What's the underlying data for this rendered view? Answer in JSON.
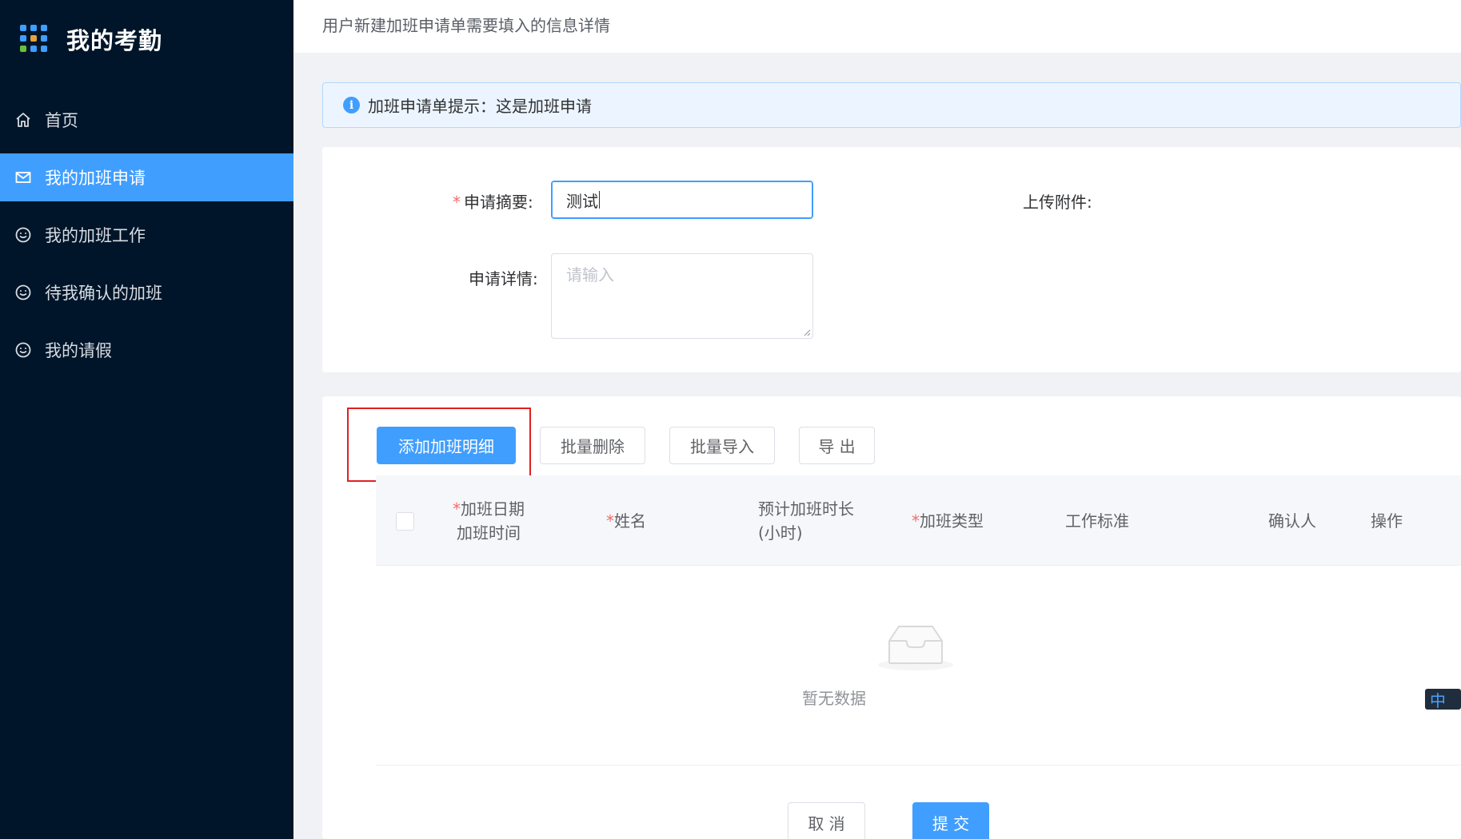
{
  "app": {
    "title": "我的考勤",
    "logo_colors": [
      "#409eff",
      "#409eff",
      "#409eff",
      "#409eff",
      "#e6a23c",
      "#409eff",
      "#67c23a",
      "#409eff",
      "#409eff"
    ]
  },
  "sidebar": {
    "items": [
      {
        "label": "首页",
        "icon": "home-icon",
        "active": false
      },
      {
        "label": "我的加班申请",
        "icon": "mail-icon",
        "active": true
      },
      {
        "label": "我的加班工作",
        "icon": "smile-icon",
        "active": false
      },
      {
        "label": "待我确认的加班",
        "icon": "smile-icon",
        "active": false
      },
      {
        "label": "我的请假",
        "icon": "smile-icon",
        "active": false
      }
    ]
  },
  "header": {
    "description": "用户新建加班申请单需要填入的信息详情"
  },
  "alert": {
    "icon": "info-icon",
    "text": "加班申请单提示：这是加班申请"
  },
  "form": {
    "summary_required_mark": "*",
    "summary_label": "申请摘要:",
    "summary_value": "测试",
    "detail_label": "申请详情:",
    "detail_placeholder": "请输入",
    "attachment_label": "上传附件:"
  },
  "toolbar": {
    "add_label": "添加加班明细",
    "batch_delete_label": "批量删除",
    "batch_import_label": "批量导入",
    "export_label": "导 出"
  },
  "table": {
    "columns": {
      "date_line1": "加班日期",
      "date_line2": "加班时间",
      "name": "姓名",
      "hours_line1": "预计加班时长",
      "hours_line2": "(小时)",
      "type": "加班类型",
      "standard": "工作标准",
      "confirmer": "确认人",
      "action": "操作"
    },
    "required_mark": "*",
    "empty_text": "暂无数据",
    "rows": []
  },
  "footer": {
    "cancel_label": "取 消",
    "submit_label": "提 交"
  },
  "ime": {
    "label": "中"
  },
  "colors": {
    "primary": "#409eff",
    "sidebar_bg": "#001529",
    "danger": "#f56c6c",
    "highlight": "#e02020"
  }
}
